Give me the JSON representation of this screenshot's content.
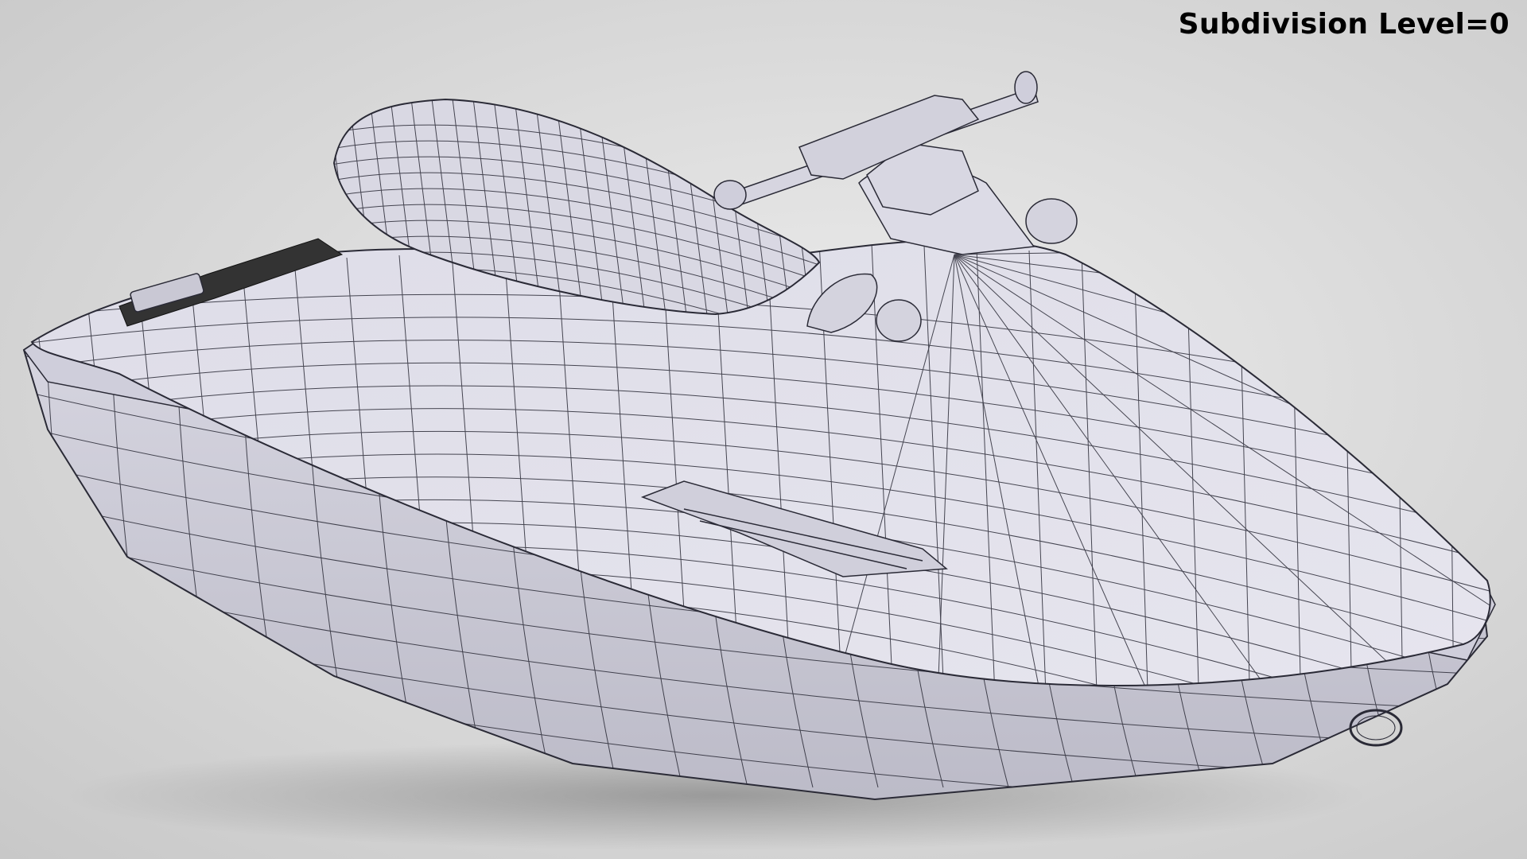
{
  "overlay": {
    "subdivision_label": "Subdivision Level=0"
  },
  "scene": {
    "subject": "jet-ski-wireframe-model",
    "background_color": "#d8d8d8",
    "model_color": "#dcdbe6",
    "wire_color": "#2a2a36"
  }
}
